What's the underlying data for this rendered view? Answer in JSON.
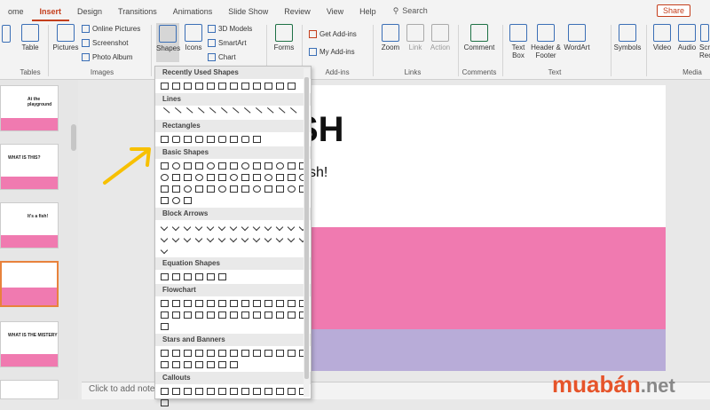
{
  "tabs": {
    "t0": "ome",
    "t1": "Insert",
    "t2": "Design",
    "t3": "Transitions",
    "t4": "Animations",
    "t5": "Slide Show",
    "t6": "Review",
    "t7": "View",
    "t8": "Help"
  },
  "search": {
    "label": "Search"
  },
  "share": {
    "label": "Share"
  },
  "ribbon": {
    "table": "Table",
    "pictures": "Pictures",
    "online_pictures": "Online Pictures",
    "screenshot": "Screenshot",
    "photo_album": "Photo Album",
    "shapes": "Shapes",
    "icons": "Icons",
    "models_3d": "3D Models",
    "smartart": "SmartArt",
    "chart": "Chart",
    "forms": "Forms",
    "get_addins": "Get Add-ins",
    "my_addins": "My Add-ins",
    "zoom": "Zoom",
    "link": "Link",
    "action": "Action",
    "comment": "Comment",
    "textbox": "Text Box",
    "header_footer": "Header & Footer",
    "wordart": "WordArt",
    "symbols": "Symbols",
    "video": "Video",
    "audio": "Audio",
    "screen_rec": "Scr Reco",
    "groups": {
      "tables": "Tables",
      "images": "Images",
      "addins": "Add-ins",
      "links": "Links",
      "comments": "Comments",
      "text": "Text",
      "media": "Media"
    }
  },
  "shapes_panel": {
    "recent": "Recently Used Shapes",
    "lines": "Lines",
    "rectangles": "Rectangles",
    "basic": "Basic Shapes",
    "block_arrows": "Block Arrows",
    "equation": "Equation Shapes",
    "flowchart": "Flowchart",
    "stars": "Stars and Banners",
    "callouts": "Callouts"
  },
  "slides": {
    "s1": "At the playground",
    "s2": "WHAT IS THIS?",
    "s3": "It's a fish!",
    "s5": "WHAT IS THE MISTERY"
  },
  "slide": {
    "title": "SH",
    "subtitle": "glish!"
  },
  "notes": {
    "placeholder": "Click to add notes"
  },
  "watermark": {
    "a": "muab",
    "b": "á",
    "c": "n",
    ".net": ".net"
  },
  "colors": {
    "accent": "#c43e1c",
    "pink": "#f07ab0",
    "lavender": "#b8acd8"
  }
}
